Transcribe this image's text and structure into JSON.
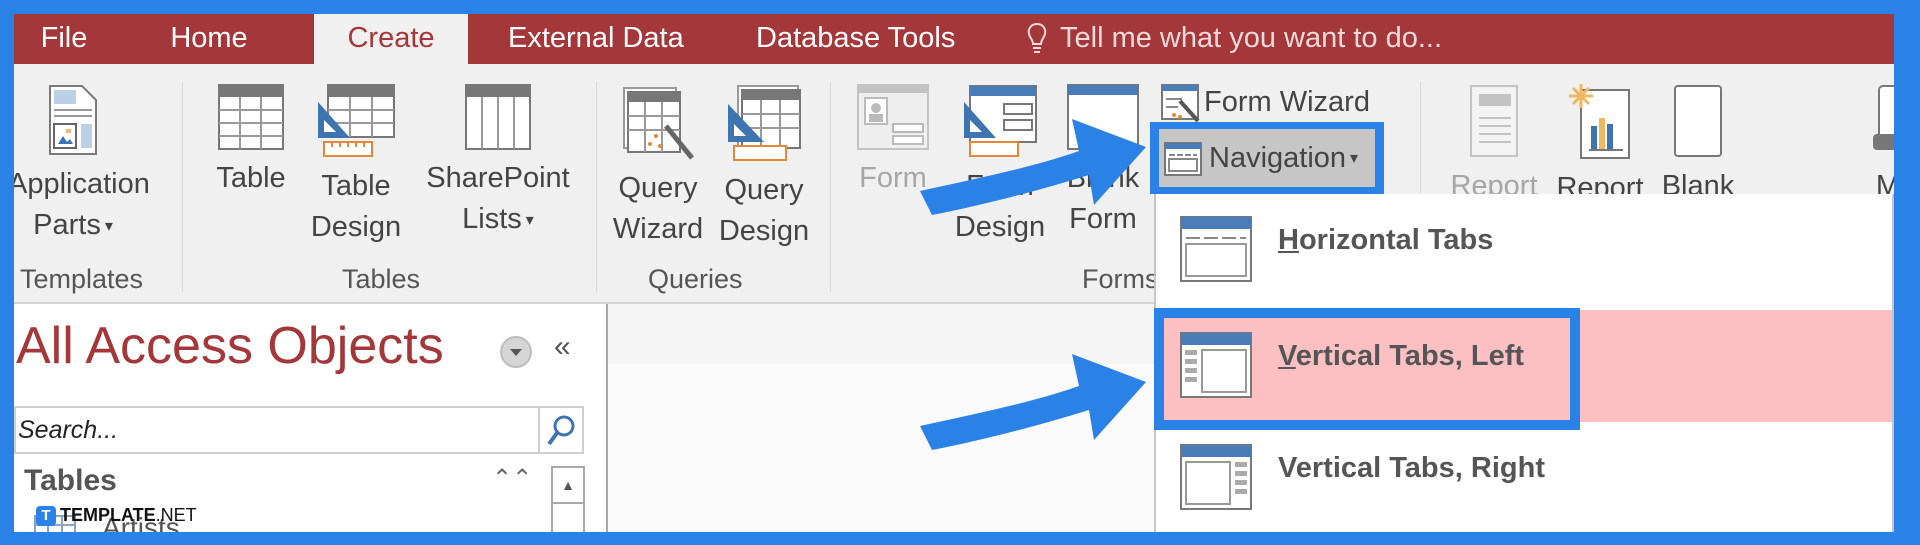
{
  "tabs": [
    {
      "label": "File",
      "active": false
    },
    {
      "label": "Home",
      "active": false
    },
    {
      "label": "Create",
      "active": true
    },
    {
      "label": "External Data",
      "active": false
    },
    {
      "label": "Database Tools",
      "active": false
    }
  ],
  "tell_me": {
    "icon": "lightbulb-icon",
    "placeholder": "Tell me what you want to do..."
  },
  "ribbon": {
    "groups": {
      "templates": {
        "label": "Templates",
        "buttons": [
          {
            "line1": "Application",
            "line2": "Parts",
            "has_dropdown": true
          }
        ]
      },
      "tables": {
        "label": "Tables",
        "buttons": [
          {
            "line1": "Table",
            "line2": ""
          },
          {
            "line1": "Table",
            "line2": "Design"
          },
          {
            "line1": "SharePoint",
            "line2": "Lists",
            "has_dropdown": true
          }
        ]
      },
      "queries": {
        "label": "Queries",
        "buttons": [
          {
            "line1": "Query",
            "line2": "Wizard"
          },
          {
            "line1": "Query",
            "line2": "Design"
          }
        ]
      },
      "forms": {
        "label": "Forms",
        "buttons": [
          {
            "line1": "Form",
            "line2": "",
            "disabled": true
          },
          {
            "line1": "Form",
            "line2": "Design"
          },
          {
            "line1": "Blank",
            "line2": "Form"
          }
        ],
        "small_buttons": [
          {
            "label": "Form Wizard"
          },
          {
            "label": "Navigation",
            "has_dropdown": true,
            "pressed": true
          }
        ]
      },
      "reports": {
        "buttons": [
          {
            "line1": "Report",
            "disabled": true
          },
          {
            "line1": "Report"
          },
          {
            "line1": "Blank"
          }
        ]
      },
      "macros": {
        "buttons": [
          {
            "line1": "Ma"
          }
        ]
      }
    }
  },
  "nav_pane": {
    "title": "All Access Objects",
    "search_placeholder": "Search...",
    "section": "Tables",
    "items": [
      "Artists"
    ]
  },
  "navigation_dropdown": {
    "items": [
      {
        "label": "Horizontal Tabs",
        "accel": "H",
        "rest": "orizontal Tabs",
        "selected": false
      },
      {
        "label": "Vertical Tabs, Left",
        "accel": "V",
        "rest": "ertical Tabs, Left",
        "selected": true
      },
      {
        "label": "Vertical Tabs, Right",
        "accel": "",
        "rest": "Vertical Tabs, Right",
        "selected": false
      }
    ]
  },
  "watermark": {
    "logo": "T",
    "brand": "TEMPLATE",
    "suffix": ".NET"
  },
  "colors": {
    "access_red": "#a4373a",
    "annotation_blue": "#2b82e6",
    "selection_pink": "#fcc0c3"
  }
}
